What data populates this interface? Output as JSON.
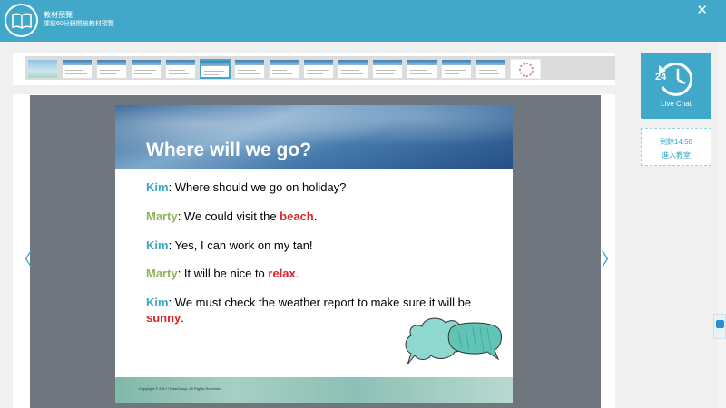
{
  "header": {
    "title": "教材預覽",
    "subtitle": "課前60分鐘開放教材預覽",
    "close": "✕"
  },
  "thumbnails": {
    "count": 15,
    "selected_index": 5
  },
  "slide": {
    "title": "Where will we go?",
    "lines": [
      {
        "speaker": "Kim",
        "text": ": Where should we go on holiday?",
        "highlight": "",
        "end": ""
      },
      {
        "speaker": "Marty",
        "text": ": We could visit the ",
        "highlight": "beach",
        "end": "."
      },
      {
        "speaker": "Kim",
        "text": ": Yes, I can work on my tan!",
        "highlight": "",
        "end": ""
      },
      {
        "speaker": "Marty",
        "text": ": It will be nice to ",
        "highlight": "relax",
        "end": "."
      },
      {
        "speaker": "Kim",
        "text": ": We must check the weather report to make sure it will be ",
        "highlight": "sunny",
        "end": "."
      }
    ],
    "copyright": "Copyright © 2017 iTutorGroup. All Rights Reserved."
  },
  "nav": {
    "prev": "〈",
    "next": "〉"
  },
  "chat": {
    "icon_number": "24",
    "label": "Live Chat"
  },
  "classroom": {
    "countdown": "剩餘14:58",
    "enter": "進入教室"
  },
  "colors": {
    "accent": "#42a8c9",
    "kim": "#3aa7c7",
    "marty": "#8fb35b",
    "highlight": "#d8262a"
  }
}
